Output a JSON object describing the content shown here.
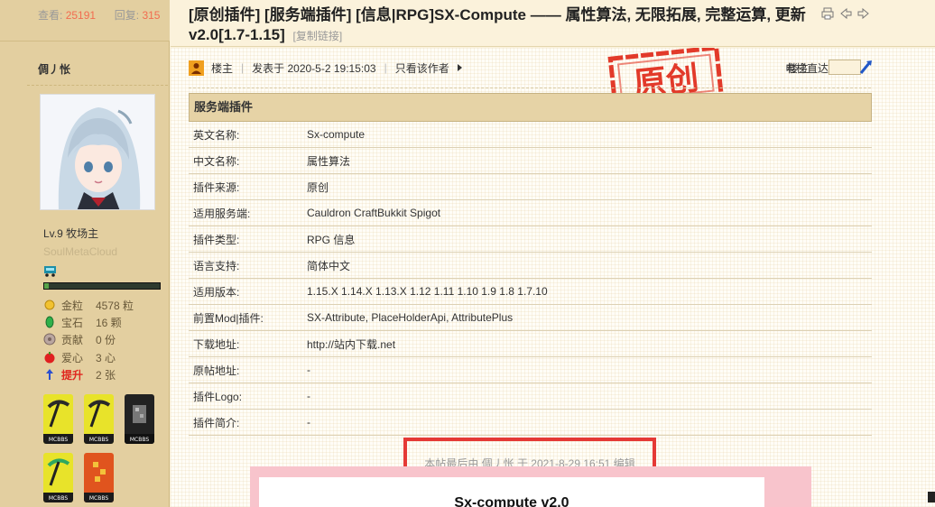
{
  "stats": {
    "views_label": "查看:",
    "views": "25191",
    "replies_label": "回复:",
    "replies": "315"
  },
  "thread": {
    "title": "[原创插件] [服务端插件] [信息|RPG]SX-Compute —— 属性算法, 无限拓展, 完整运算, 更新v2.0[1.7-1.15]",
    "copy_link": "[复制链接]"
  },
  "author": {
    "name": "倜丿怅",
    "level": "Lv.9 牧场主",
    "subname": "SoulMetaCloud",
    "progress": 0.04,
    "attributes": [
      {
        "icon": "gold-icon",
        "label": "金粒",
        "value": "4578 粒",
        "highlight": false
      },
      {
        "icon": "gem-icon",
        "label": "宝石",
        "value": "16 颗",
        "highlight": false
      },
      {
        "icon": "contribution-icon",
        "label": "贡献",
        "value": "0 份",
        "highlight": false
      },
      {
        "icon": "heart-icon",
        "label": "爱心",
        "value": "3 心",
        "highlight": false
      },
      {
        "icon": "promote-icon",
        "label": "提升",
        "value": "2 张",
        "highlight": true
      }
    ],
    "badge_labels": [
      "MCBBS",
      "MCBBS",
      "MCBBS",
      "MCBBS",
      "MCBBS"
    ]
  },
  "post": {
    "op_label": "楼主",
    "posted": "发表于 2020-5-2 19:15:03",
    "only_author": "只看该作者",
    "floor": "楼主",
    "elevator": "电梯直达",
    "elevator_value": "",
    "stamp_text": "原创"
  },
  "info": {
    "header": "服务端插件",
    "rows": [
      {
        "k": "英文名称:",
        "v": "Sx-compute"
      },
      {
        "k": "中文名称:",
        "v": "属性算法"
      },
      {
        "k": "插件来源:",
        "v": "原创"
      },
      {
        "k": "适用服务端:",
        "v": "Cauldron CraftBukkit Spigot"
      },
      {
        "k": "插件类型:",
        "v": "RPG 信息"
      },
      {
        "k": "语言支持:",
        "v": "简体中文"
      },
      {
        "k": "适用版本:",
        "v": "1.15.X 1.14.X 1.13.X 1.12 1.11 1.10 1.9 1.8 1.7.10"
      },
      {
        "k": "前置Mod|插件:",
        "v": "SX-Attribute, PlaceHolderApi, AttributePlus"
      },
      {
        "k": "下载地址:",
        "v": "http://站内下载.net"
      },
      {
        "k": "原帖地址:",
        "v": "-"
      },
      {
        "k": "插件Logo:",
        "v": "-"
      },
      {
        "k": "插件简介:",
        "v": "-"
      }
    ]
  },
  "edit_note": "本帖最后由 倜丿怅 于 2021-8-29 16:51 编辑",
  "subtitle": "Sx-compute v2.0",
  "colors": {
    "accent_red": "#e53935",
    "header_bg": "#e6d3a6",
    "side_bg": "#e3cfa0"
  }
}
